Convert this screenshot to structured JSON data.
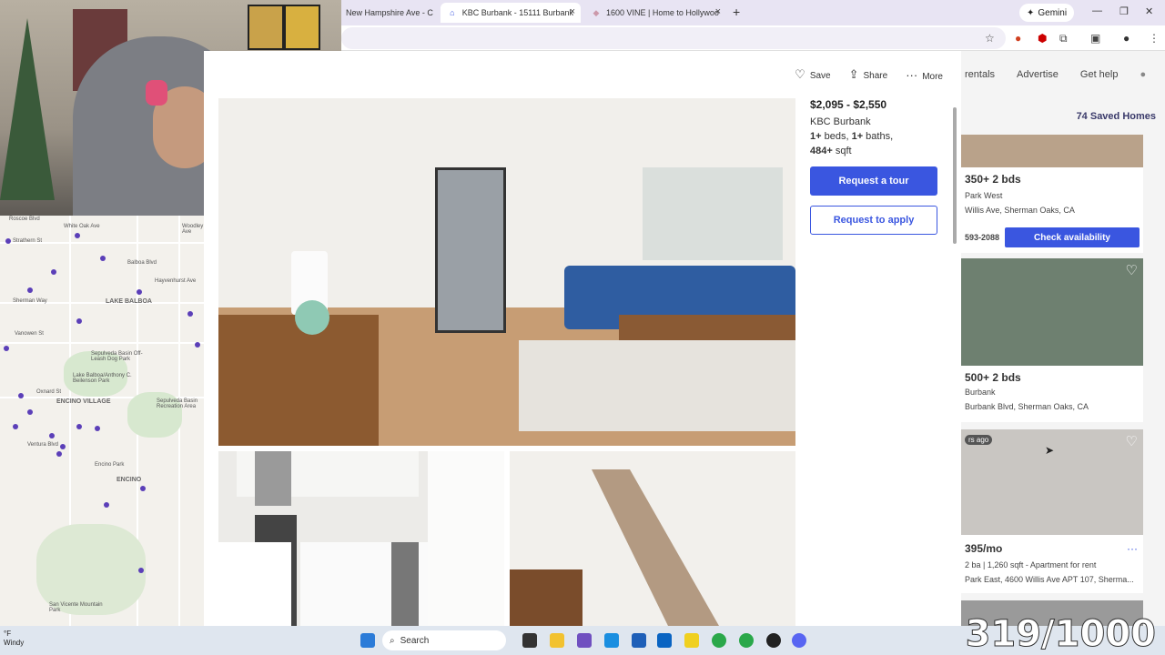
{
  "browser": {
    "tabs": [
      {
        "label": "New Hampshire Ave - C"
      },
      {
        "label": "KBC Burbank - 15111 Burbank"
      },
      {
        "label": "1600 VINE | Home to Hollywoo"
      }
    ],
    "gemini_label": "Gemini"
  },
  "listing": {
    "actions": {
      "save": "Save",
      "share": "Share",
      "more": "More"
    },
    "price": "$2,095 - $2,550",
    "name": "KBC Burbank",
    "beds": "1+",
    "beds_label": " beds, ",
    "baths": "1+",
    "baths_label": " baths,",
    "sqft": "484+",
    "sqft_label": " sqft",
    "tour_button": "Request a tour",
    "apply_button": "Request to apply"
  },
  "results": {
    "nav": [
      "rentals",
      "Advertise",
      "Get help"
    ],
    "saved_homes": "74 Saved Homes",
    "cards": [
      {
        "title": "350+ 2 bds",
        "line1": "Park West",
        "line2": "Willis Ave, Sherman Oaks, CA",
        "phone": "593-2088",
        "cta": "Check availability"
      },
      {
        "title": "500+ 2 bds",
        "line1": "Burbank",
        "line2": "Burbank Blvd, Sherman Oaks, CA"
      },
      {
        "badge": "rs ago",
        "title": "395/mo",
        "line1": "2 ba | 1,260 sqft - Apartment for rent",
        "line2": "Park East, 4600 Willis Ave APT 107, Sherma..."
      }
    ]
  },
  "map": {
    "labels": [
      "Roscoe Blvd",
      "Strathern St",
      "Sherman Way",
      "Vanowen St",
      "LAKE BALBOA",
      "Sepulveda Basin Off-Leash Dog Park",
      "Lake Balboa/Anthony C. Beilenson Park",
      "Sepulveda Basin Recreation Area",
      "ENCINO VILLAGE",
      "Encino Park",
      "ENCINO",
      "San Vicente Mountain Park",
      "Oxnard St",
      "Ventura Blvd",
      "White Oak Ave",
      "Balboa Blvd",
      "Hayvenhurst Ave",
      "Woodley Ave"
    ]
  },
  "taskbar": {
    "search": "Search",
    "weather_temp": "°F",
    "weather_desc": "Windy"
  },
  "overlay_counter": "319/1000"
}
